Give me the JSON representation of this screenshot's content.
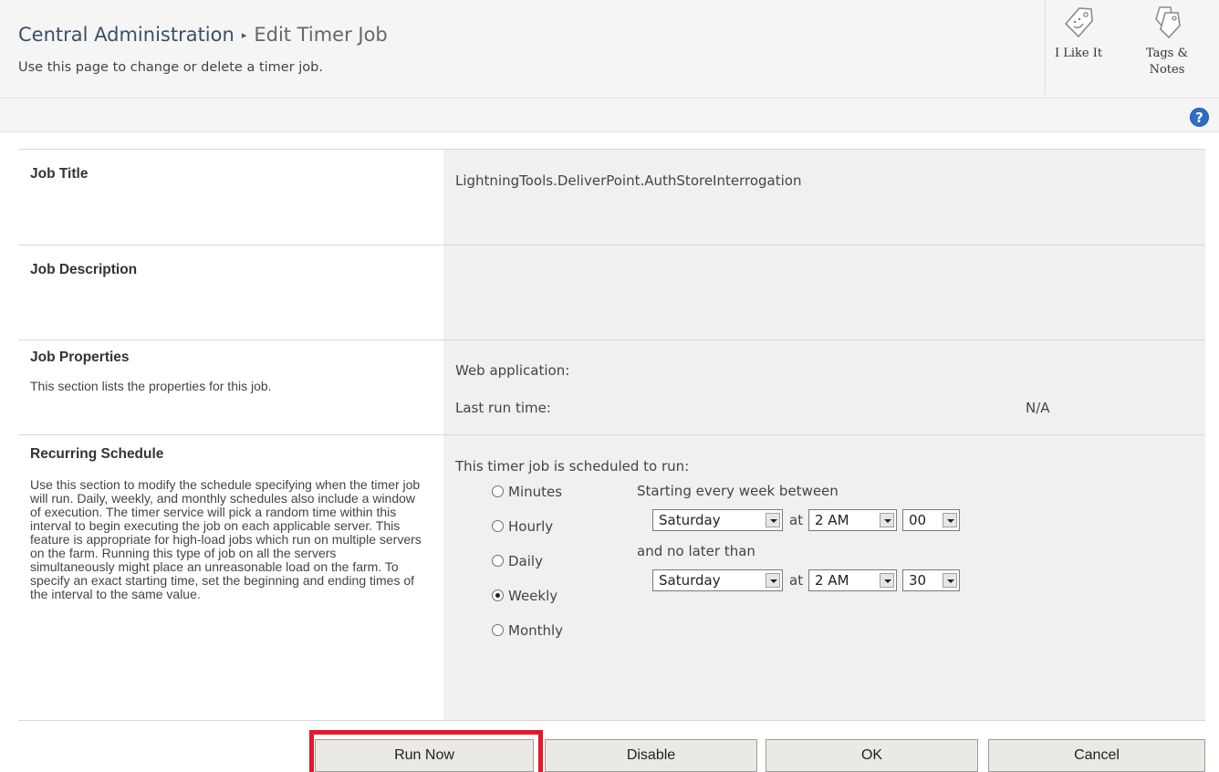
{
  "header": {
    "breadcrumb_root": "Central Administration",
    "breadcrumb_separator": "▸",
    "breadcrumb_current": "Edit Timer Job",
    "subtitle": "Use this page to change or delete a timer job.",
    "like_label": "I Like It",
    "tags_label_line1": "Tags &",
    "tags_label_line2": "Notes",
    "help_glyph": "?"
  },
  "sections": {
    "job_title": {
      "heading": "Job Title",
      "value": "LightningTools.DeliverPoint.AuthStoreInterrogation"
    },
    "job_description": {
      "heading": "Job Description"
    },
    "job_properties": {
      "heading": "Job Properties",
      "description": "This section lists the properties for this job.",
      "web_application_label": "Web application:",
      "last_run_label": "Last run time:",
      "last_run_value": "N/A"
    },
    "schedule": {
      "heading": "Recurring Schedule",
      "description": "Use this section to modify the schedule specifying when the timer job will run. Daily, weekly, and monthly schedules also include a window of execution. The timer service will pick a random time within this interval to begin executing the job on each applicable server. This feature is appropriate for high-load jobs which run on multiple servers on the farm. Running this type of job on all the servers simultaneously might place an unreasonable load on the farm. To specify an exact starting time, set the beginning and ending times of the interval to the same value.",
      "intro": "This timer job is scheduled to run:",
      "options": [
        "Minutes",
        "Hourly",
        "Daily",
        "Weekly",
        "Monthly"
      ],
      "selected_option": "Weekly",
      "start_label": "Starting every week between",
      "start_day": "Saturday",
      "at_label": "at",
      "start_hour": "2 AM",
      "start_minute": "00",
      "end_label": "and no later than",
      "end_day": "Saturday",
      "end_hour": "2 AM",
      "end_minute": "30"
    }
  },
  "buttons": {
    "run_now": "Run Now",
    "disable": "Disable",
    "ok": "OK",
    "cancel": "Cancel"
  },
  "colors": {
    "highlight": "#e3182a",
    "help_icon": "#2b6ec2"
  },
  "icons": {
    "like": "like-tag-icon",
    "tags": "tags-notes-icon",
    "help": "help-icon"
  }
}
